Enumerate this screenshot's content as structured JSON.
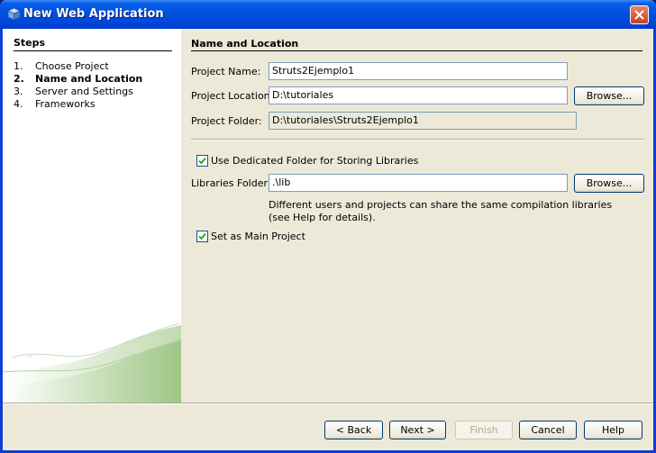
{
  "window": {
    "title": "New Web Application"
  },
  "steps": {
    "heading": "Steps",
    "items": [
      {
        "num": "1.",
        "label": "Choose Project"
      },
      {
        "num": "2.",
        "label": "Name and Location"
      },
      {
        "num": "3.",
        "label": "Server and Settings"
      },
      {
        "num": "4.",
        "label": "Frameworks"
      }
    ]
  },
  "main": {
    "section_title": "Name and Location",
    "project_name_label": "Project Name:",
    "project_name_value": "Struts2Ejemplo1",
    "project_location_label": "Project Location:",
    "project_location_value": "D:\\tutoriales",
    "project_folder_label": "Project Folder:",
    "project_folder_value": "D:\\tutoriales\\Struts2Ejemplo1",
    "browse_label": "Browse...",
    "dedicated_folder_label": "Use Dedicated Folder for Storing Libraries",
    "dedicated_folder_checked": true,
    "libraries_folder_label": "Libraries Folder:",
    "libraries_folder_value": ".\\lib",
    "libraries_help_line1": "Different users and projects can share the same compilation libraries",
    "libraries_help_line2": "(see Help for details).",
    "main_project_label": "Set as Main Project",
    "main_project_checked": true
  },
  "footer": {
    "back": "< Back",
    "next": "Next >",
    "finish": "Finish",
    "cancel": "Cancel",
    "help": "Help"
  },
  "colors": {
    "titlebar": "#0054e3",
    "accent_green": "#9bc97e"
  },
  "icons": {
    "window": "cube-icon",
    "close": "close-icon",
    "check": "checkmark-icon"
  }
}
